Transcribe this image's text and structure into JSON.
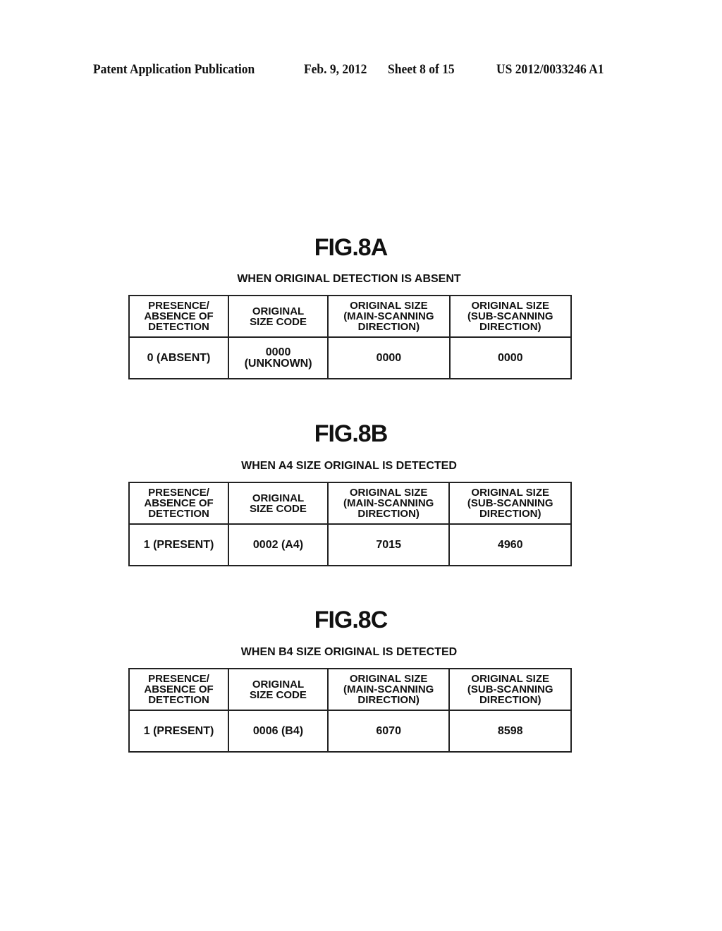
{
  "header": {
    "publication": "Patent Application Publication",
    "date": "Feb. 9, 2012",
    "sheet": "Sheet 8 of 15",
    "number": "US 2012/0033246 A1"
  },
  "columns": [
    "PRESENCE/\nABSENCE OF\nDETECTION",
    "ORIGINAL\nSIZE CODE",
    "ORIGINAL SIZE\n(MAIN-SCANNING\nDIRECTION)",
    "ORIGINAL SIZE\n(SUB-SCANNING\nDIRECTION)"
  ],
  "figures": [
    {
      "title": "FIG.8A",
      "subtitle": "WHEN ORIGINAL DETECTION IS ABSENT",
      "row": [
        "0 (ABSENT)",
        "0000\n(UNKNOWN)",
        "0000",
        "0000"
      ]
    },
    {
      "title": "FIG.8B",
      "subtitle": "WHEN A4 SIZE ORIGINAL IS DETECTED",
      "row": [
        "1 (PRESENT)",
        "0002 (A4)",
        "7015",
        "4960"
      ]
    },
    {
      "title": "FIG.8C",
      "subtitle": "WHEN B4 SIZE ORIGINAL IS DETECTED",
      "row": [
        "1 (PRESENT)",
        "0006 (B4)",
        "6070",
        "8598"
      ]
    }
  ]
}
